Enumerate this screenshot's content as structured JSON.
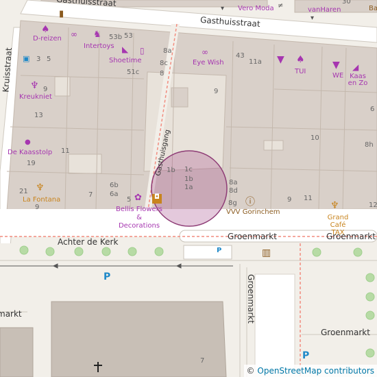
{
  "streets": {
    "gasthuisstraat_top": "Gasthuisstraat",
    "gasthuisstraat": "Gasthuisstraat",
    "kruisstraat": "Kruisstraat",
    "gasthuisgang": "Gasthuisgang",
    "achter_de_kerk": "Achter de Kerk",
    "groenmarkt_1": "Groenmarkt",
    "groenmarkt_2": "Groenmarkt",
    "groenmarkt_vertical": "Groenmarkt",
    "groenmarkt_low": "Groenmarkt",
    "markt_partial": "markt"
  },
  "pois": {
    "vero_moda": "Vero Moda",
    "van_haren": "vanHaren",
    "ba_partial": "Ba",
    "d_reizen": "D-reizen",
    "intertoys": "Intertoys",
    "shoetime": "Shoetime",
    "eye_wish": "Eye Wish",
    "tui": "TUI",
    "we": "WE",
    "kaas_en_zo": "Kaas en Zo",
    "kreukniet": "Kreukniet",
    "de_kaasstolp": "De Kaasstolp",
    "la_fontana": "La Fontana",
    "bellis_flowers": "Bellis Flowers & Decorations",
    "vvv": "VVV Gorinchem",
    "grand_cafe": "Grand Café TAX"
  },
  "house_numbers": {
    "n30": "30",
    "n53b": "53b",
    "n53": "53",
    "n3": "3",
    "n5": "5",
    "n8a": "8a",
    "n43": "43",
    "n11a": "11a",
    "n8c": "8c",
    "n51c": "51c",
    "n8": "8",
    "n9a": "9",
    "n9b": "9",
    "n13": "13",
    "n11": "11",
    "n19": "19",
    "n10": "10",
    "n8h": "8h",
    "n6": "6",
    "n1b": "1b",
    "n1c": "1c",
    "n1bb": "1b",
    "n1a": "1a",
    "n6b": "6b",
    "n6a": "6a",
    "n7": "7",
    "n5b": "5",
    "n8a2": "8a",
    "n8d": "8d",
    "n8g": "8g",
    "n9c": "9",
    "n11b": "11",
    "n21": "21",
    "n9d": "9",
    "n12": "12",
    "n7b": "7"
  },
  "parking_label": "P",
  "attribution": {
    "copyright": "©",
    "link": "OpenStreetMap contributors"
  },
  "highlight_color": "#a64d8c",
  "poi_color": "#a636b0"
}
